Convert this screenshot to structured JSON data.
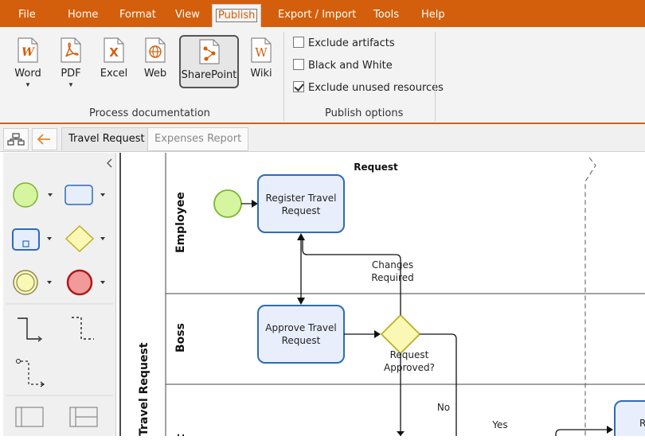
{
  "menu": {
    "items": [
      "File",
      "Home",
      "Format",
      "View",
      "Publish",
      "Export / Import",
      "Tools",
      "Help"
    ]
  },
  "ribbon": {
    "buttons": [
      {
        "label": "Word",
        "icon": "word-icon",
        "has_dropdown": true
      },
      {
        "label": "PDF",
        "icon": "pdf-icon",
        "has_dropdown": true
      },
      {
        "label": "Excel",
        "icon": "excel-icon",
        "has_dropdown": false
      },
      {
        "label": "Web",
        "icon": "web-icon",
        "has_dropdown": false
      },
      {
        "label": "SharePoint",
        "icon": "sharepoint-icon",
        "has_dropdown": false
      },
      {
        "label": "Wiki",
        "icon": "wiki-icon",
        "has_dropdown": false
      }
    ],
    "group_process": "Process documentation",
    "options": [
      {
        "label": "Exclude artifacts",
        "checked": false
      },
      {
        "label": "Black and White",
        "checked": false
      },
      {
        "label": "Exclude unused resources",
        "checked": true
      }
    ],
    "group_publish": "Publish options",
    "accent": "#d35f0c"
  },
  "tabs": {
    "active": "Travel Request",
    "inactive": "Expenses Report"
  },
  "diagram": {
    "pool_title": "Travel Request",
    "phase_title": "Request",
    "lanes": [
      "Employee",
      "Boss"
    ],
    "lane3_partial": "t",
    "task_register": [
      "Register Travel",
      "Request"
    ],
    "task_approve": [
      "Approve Travel",
      "Request"
    ],
    "task_partial": [
      "R",
      "R"
    ],
    "gateway": [
      "Request",
      "Approved?"
    ],
    "flow_changes": [
      "Changes",
      "Required"
    ],
    "flow_no": "No",
    "flow_yes": "Yes"
  }
}
